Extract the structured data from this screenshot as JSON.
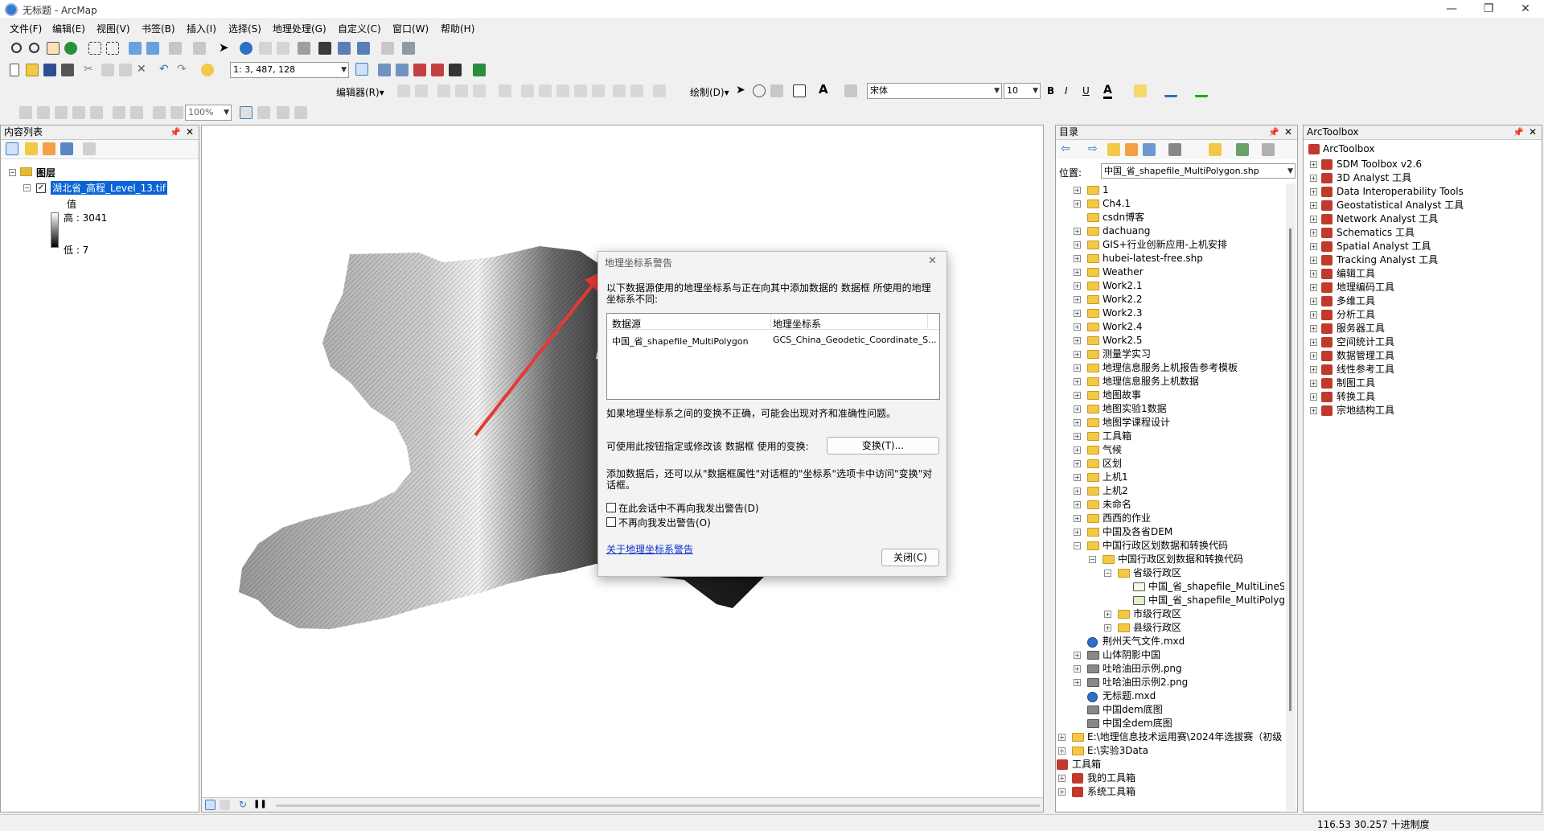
{
  "window": {
    "title": "无标题 - ArcMap",
    "min": "—",
    "max": "❐",
    "close": "✕"
  },
  "menu": [
    "文件(F)",
    "编辑(E)",
    "视图(V)",
    "书签(B)",
    "插入(I)",
    "选择(S)",
    "地理处理(G)",
    "自定义(C)",
    "窗口(W)",
    "帮助(H)"
  ],
  "toolbar": {
    "scale": "1: 3, 487, 128",
    "editor": "编辑器(R)▾",
    "draw": "绘制(D)▾",
    "font": "宋体",
    "fontsize": "10",
    "bold": "B",
    "italic": "I",
    "underline": "U",
    "font_color": "A",
    "zoom_pct": "100%"
  },
  "toc": {
    "title": "内容列表",
    "root": "图层",
    "layer": "湖北省_高程_Level_13.tif",
    "value_label": "值",
    "high": "高 : 3041",
    "low": "低 : 7"
  },
  "dialog": {
    "title": "地理坐标系警告",
    "message": "以下数据源使用的地理坐标系与正在向其中添加数据的 数据框 所使用的地理坐标系不同:",
    "col_source": "数据源",
    "col_gcs": "地理坐标系",
    "row_source": "中国_省_shapefile_MultiPolygon",
    "row_gcs": "GCS_China_Geodetic_Coordinate_S...",
    "warn1": "如果地理坐标系之间的变换不正确，可能会出现对齐和准确性问题。",
    "warn2": "可使用此按钮指定或修改该 数据框 使用的变换:",
    "transform_btn": "变换(T)...",
    "warn3": "添加数据后，还可以从\"数据框属性\"对话框的\"坐标系\"选项卡中访问\"变换\"对话框。",
    "chk1": "在此会话中不再向我发出警告(D)",
    "chk2": "不再向我发出警告(O)",
    "link": "关于地理坐标系警告",
    "close_btn": "关闭(C)"
  },
  "catalog": {
    "title": "目录",
    "loc_label": "位置:",
    "location": "中国_省_shapefile_MultiPolygon.shp",
    "items": [
      {
        "t": "1",
        "lv": 1,
        "k": "f",
        "e": "+"
      },
      {
        "t": "Ch4.1",
        "lv": 1,
        "k": "f",
        "e": "+"
      },
      {
        "t": "csdn博客",
        "lv": 1,
        "k": "f",
        "e": ""
      },
      {
        "t": "dachuang",
        "lv": 1,
        "k": "f",
        "e": "+"
      },
      {
        "t": "GIS+行业创新应用-上机安排",
        "lv": 1,
        "k": "f",
        "e": "+"
      },
      {
        "t": "hubei-latest-free.shp",
        "lv": 1,
        "k": "f",
        "e": "+"
      },
      {
        "t": "Weather",
        "lv": 1,
        "k": "f",
        "e": "+"
      },
      {
        "t": "Work2.1",
        "lv": 1,
        "k": "f",
        "e": "+"
      },
      {
        "t": "Work2.2",
        "lv": 1,
        "k": "f",
        "e": "+"
      },
      {
        "t": "Work2.3",
        "lv": 1,
        "k": "f",
        "e": "+"
      },
      {
        "t": "Work2.4",
        "lv": 1,
        "k": "f",
        "e": "+"
      },
      {
        "t": "Work2.5",
        "lv": 1,
        "k": "f",
        "e": "+"
      },
      {
        "t": "测量学实习",
        "lv": 1,
        "k": "f",
        "e": "+"
      },
      {
        "t": "地理信息服务上机报告参考模板",
        "lv": 1,
        "k": "f",
        "e": "+"
      },
      {
        "t": "地理信息服务上机数据",
        "lv": 1,
        "k": "f",
        "e": "+"
      },
      {
        "t": "地图故事",
        "lv": 1,
        "k": "f",
        "e": "+"
      },
      {
        "t": "地图实验1数据",
        "lv": 1,
        "k": "f",
        "e": "+"
      },
      {
        "t": "地图学课程设计",
        "lv": 1,
        "k": "f",
        "e": "+"
      },
      {
        "t": "工具箱",
        "lv": 1,
        "k": "f",
        "e": "+"
      },
      {
        "t": "气候",
        "lv": 1,
        "k": "f",
        "e": "+"
      },
      {
        "t": "区划",
        "lv": 1,
        "k": "f",
        "e": "+"
      },
      {
        "t": "上机1",
        "lv": 1,
        "k": "f",
        "e": "+"
      },
      {
        "t": "上机2",
        "lv": 1,
        "k": "f",
        "e": "+"
      },
      {
        "t": "未命名",
        "lv": 1,
        "k": "f",
        "e": "+"
      },
      {
        "t": "西西的作业",
        "lv": 1,
        "k": "f",
        "e": "+"
      },
      {
        "t": "中国及各省DEM",
        "lv": 1,
        "k": "f",
        "e": "+"
      },
      {
        "t": "中国行政区划数据和转换代码",
        "lv": 1,
        "k": "f",
        "e": "−"
      },
      {
        "t": "中国行政区划数据和转换代码",
        "lv": 2,
        "k": "f",
        "e": "−"
      },
      {
        "t": "省级行政区",
        "lv": 3,
        "k": "f",
        "e": "−"
      },
      {
        "t": "中国_省_shapefile_MultiLineSt",
        "lv": 4,
        "k": "l",
        "e": ""
      },
      {
        "t": "中国_省_shapefile_MultiPolyg",
        "lv": 4,
        "k": "p",
        "e": ""
      },
      {
        "t": "市级行政区",
        "lv": 3,
        "k": "f",
        "e": "+"
      },
      {
        "t": "县级行政区",
        "lv": 3,
        "k": "f",
        "e": "+"
      },
      {
        "t": "荆州天气文件.mxd",
        "lv": 1,
        "k": "m",
        "e": ""
      },
      {
        "t": "山体阴影中国",
        "lv": 1,
        "k": "r",
        "e": "+"
      },
      {
        "t": "吐哈油田示例.png",
        "lv": 1,
        "k": "r",
        "e": "+"
      },
      {
        "t": "吐哈油田示例2.png",
        "lv": 1,
        "k": "r",
        "e": "+"
      },
      {
        "t": "无标题.mxd",
        "lv": 1,
        "k": "m",
        "e": ""
      },
      {
        "t": "中国dem底图",
        "lv": 1,
        "k": "r",
        "e": ""
      },
      {
        "t": "中国全dem底图",
        "lv": 1,
        "k": "r",
        "e": ""
      },
      {
        "t": "E:\\地理信息技术运用赛\\2024年选拔赛（初级",
        "lv": 0,
        "k": "f",
        "e": "+"
      },
      {
        "t": "E:\\实验3Data",
        "lv": 0,
        "k": "f",
        "e": "+"
      },
      {
        "t": "工具箱",
        "lv": -1,
        "k": "b",
        "e": ""
      },
      {
        "t": "我的工具箱",
        "lv": 0,
        "k": "b",
        "e": "+"
      },
      {
        "t": "系统工具箱",
        "lv": 0,
        "k": "b",
        "e": "+"
      }
    ]
  },
  "toolbox": {
    "title": "ArcToolbox",
    "root": "ArcToolbox",
    "items": [
      "SDM Toolbox v2.6",
      "3D Analyst 工具",
      "Data Interoperability Tools",
      "Geostatistical Analyst 工具",
      "Network Analyst 工具",
      "Schematics 工具",
      "Spatial Analyst 工具",
      "Tracking Analyst 工具",
      "编辑工具",
      "地理编码工具",
      "多维工具",
      "分析工具",
      "服务器工具",
      "空间统计工具",
      "数据管理工具",
      "线性参考工具",
      "制图工具",
      "转换工具",
      "宗地结构工具"
    ]
  },
  "status": {
    "coords": "116.53  30.257 十进制度"
  }
}
